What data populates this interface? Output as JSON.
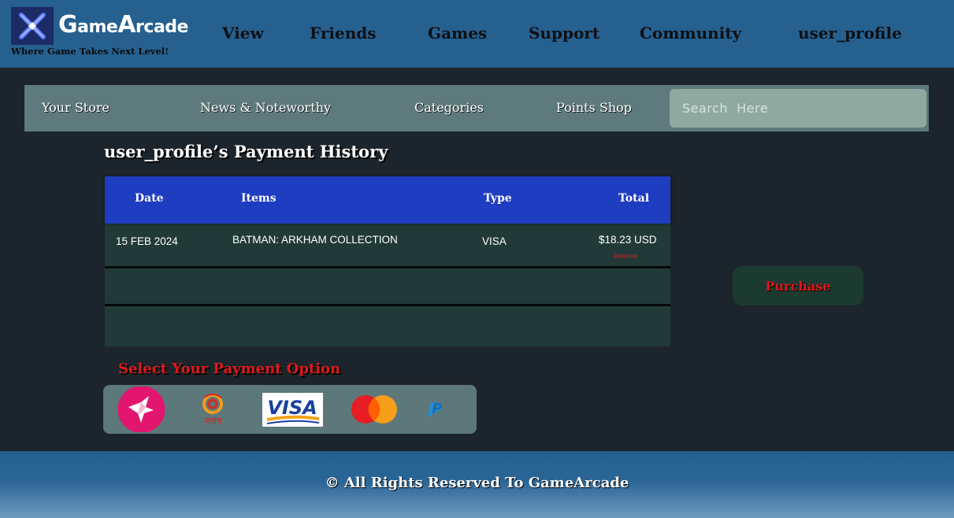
{
  "brand": {
    "name_part1_initial": "G",
    "name_part1_rest": "ame",
    "name_part2_initial": "A",
    "name_part2_rest": "rcade",
    "tagline": "Where Game Takes Next Level!",
    "logo_icon": "x-logo-icon"
  },
  "nav": {
    "items": [
      "View",
      "Friends",
      "Games",
      "Support",
      "Community",
      "user_profile"
    ]
  },
  "storebar": {
    "items": [
      "Your Store",
      "News & Noteworthy",
      "Categories",
      "Points Shop"
    ],
    "search_placeholder": "Search  Here"
  },
  "page": {
    "title": "user_profile’s Payment History"
  },
  "table": {
    "headers": [
      "Date",
      "Items",
      "Type",
      "Total"
    ],
    "rows": [
      {
        "date": "15 FEB 2024",
        "item": "BATMAN: ARKHAM COLLECTION",
        "type": "VISA",
        "total": "$18.23 USD",
        "remove_label": "Remove"
      }
    ]
  },
  "purchase": {
    "label": "Purchase"
  },
  "payment": {
    "title": "Select Your Payment Option",
    "options": [
      {
        "name": "birdpay",
        "icon": "bird-icon"
      },
      {
        "name": "Nagad",
        "icon": "nagad-icon",
        "text": "নগদ"
      },
      {
        "name": "VISA",
        "icon": "visa-icon",
        "text": "VISA"
      },
      {
        "name": "Mastercard",
        "icon": "mastercard-icon"
      },
      {
        "name": "PayPal",
        "icon": "paypal-icon",
        "text": "P"
      }
    ]
  },
  "footer": {
    "text": "© All Rights Reserved To GameArcade"
  },
  "colors": {
    "header_bg": "#26608f",
    "page_bg": "#1c252b",
    "table_header_bg": "#1f3dc0",
    "accent_red": "#e01818"
  }
}
